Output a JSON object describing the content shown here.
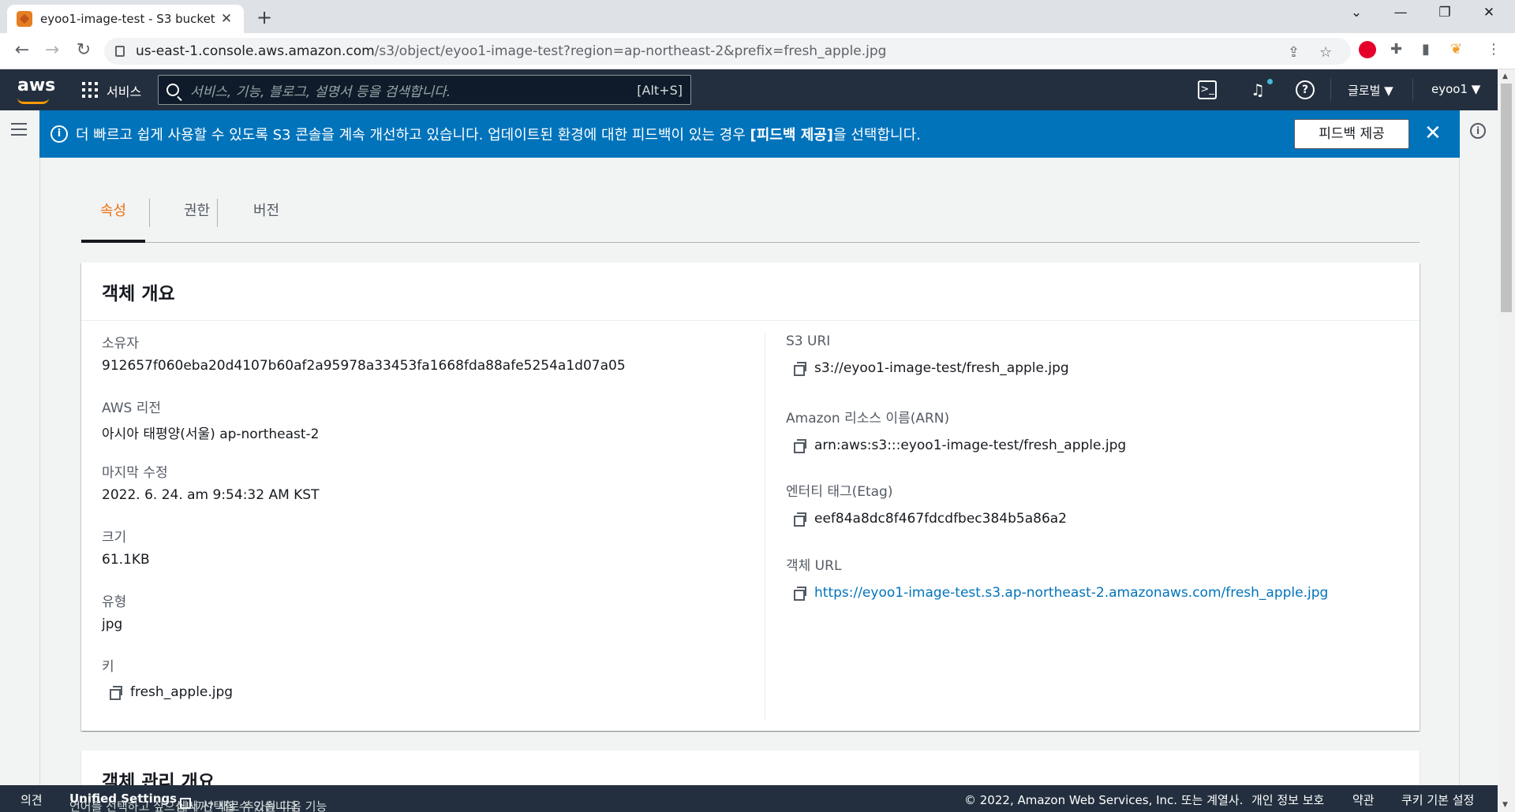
{
  "browser": {
    "tab_title": "eyoo1-image-test - S3 bucket",
    "url_host": "us-east-1.console.aws.amazon.com",
    "url_path": "/s3/object/eyoo1-image-test?region=ap-northeast-2&prefix=fresh_apple.jpg"
  },
  "aws_header": {
    "logo": "aws",
    "services_label": "서비스",
    "search_placeholder": "서비스, 기능, 블로그, 설명서 등을 검색합니다.",
    "search_shortcut": "[Alt+S]",
    "region": "글로벌 ▼",
    "account": "eyoo1 ▼"
  },
  "banner": {
    "message_pre": "더 빠르고 쉽게 사용할 수 있도록 S3 콘솔을 계속 개선하고 있습니다. 업데이트된 환경에 대한 피드백이 있는 경우 ",
    "message_bold": "[피드백 제공]",
    "message_post": "을 선택합니다.",
    "feedback_button": "피드백 제공"
  },
  "tabs": [
    {
      "label": "속성",
      "active": true
    },
    {
      "label": "권한",
      "active": false
    },
    {
      "label": "버전",
      "active": false
    }
  ],
  "overview": {
    "title": "객체 개요",
    "owner_label": "소유자",
    "owner_value": "912657f060eba20d4107b60af2a95978a33453fa1668fda88afe5254a1d07a05",
    "region_label": "AWS 리전",
    "region_value": "아시아 태평양(서울) ap-northeast-2",
    "modified_label": "마지막 수정",
    "modified_value": "2022. 6. 24. am 9:54:32 AM KST",
    "size_label": "크기",
    "size_value": "61.1KB",
    "type_label": "유형",
    "type_value": "jpg",
    "key_label": "키",
    "key_value": "fresh_apple.jpg",
    "s3uri_label": "S3 URI",
    "s3uri_value": "s3://eyoo1-image-test/fresh_apple.jpg",
    "arn_label": "Amazon 리소스 이름(ARN)",
    "arn_value": "arn:aws:s3:::eyoo1-image-test/fresh_apple.jpg",
    "etag_label": "엔터티 태그(Etag)",
    "etag_value": "eef84a8dc8f467fdcdfbec384b5a86a2",
    "url_label": "객체 URL",
    "url_value": "https://eyoo1-image-test.s3.ap-northeast-2.amazonaws.com/fresh_apple.jpg"
  },
  "mgmt": {
    "title": "객체 관리 개요"
  },
  "footer": {
    "feedback": "의견",
    "lang_pre": "언어를 선택하고 싶으십니까? 새로 추가된 다음 기능",
    "lang_link": "Unified Settings",
    "lang_post": "에서 선택할 수 있습니다.",
    "copyright": "© 2022, Amazon Web Services, Inc. 또는 계열사.",
    "privacy": "개인 정보 보호",
    "terms": "약관",
    "cookies": "쿠키 기본 설정"
  }
}
